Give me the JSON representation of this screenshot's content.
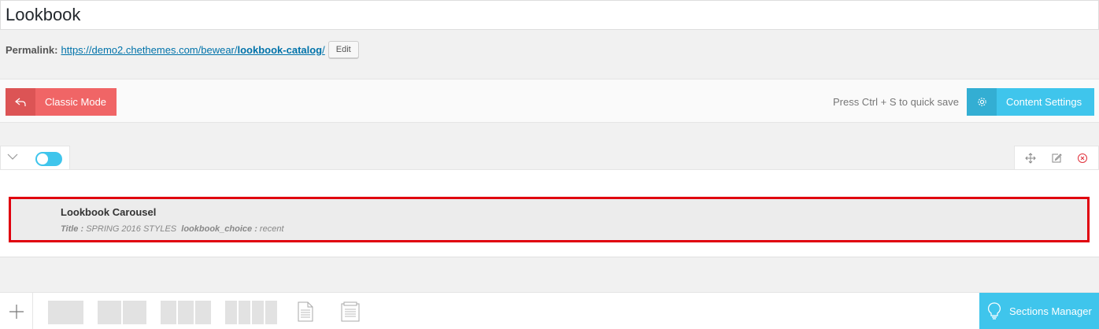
{
  "page": {
    "title": "Lookbook"
  },
  "permalink": {
    "label": "Permalink:",
    "url_base": "https://demo2.chethemes.com/bewear/",
    "slug": "lookbook-catalog",
    "trailing": "/",
    "edit_label": "Edit"
  },
  "toolbar": {
    "classic_mode_label": "Classic Mode",
    "quicksave_hint": "Press Ctrl + S to quick save",
    "content_settings_label": "Content Settings"
  },
  "element": {
    "title": "Lookbook Carousel",
    "param1_key": "Title :",
    "param1_value": "SPRING 2016 STYLES",
    "param2_key": "lookbook_choice :",
    "param2_value": "recent"
  },
  "bottom": {
    "sections_manager_label": "Sections Manager"
  },
  "colors": {
    "classic_red": "#f06566",
    "accent_blue": "#3fc5ec",
    "highlight_red": "#e0000f",
    "link_blue": "#0073aa"
  }
}
